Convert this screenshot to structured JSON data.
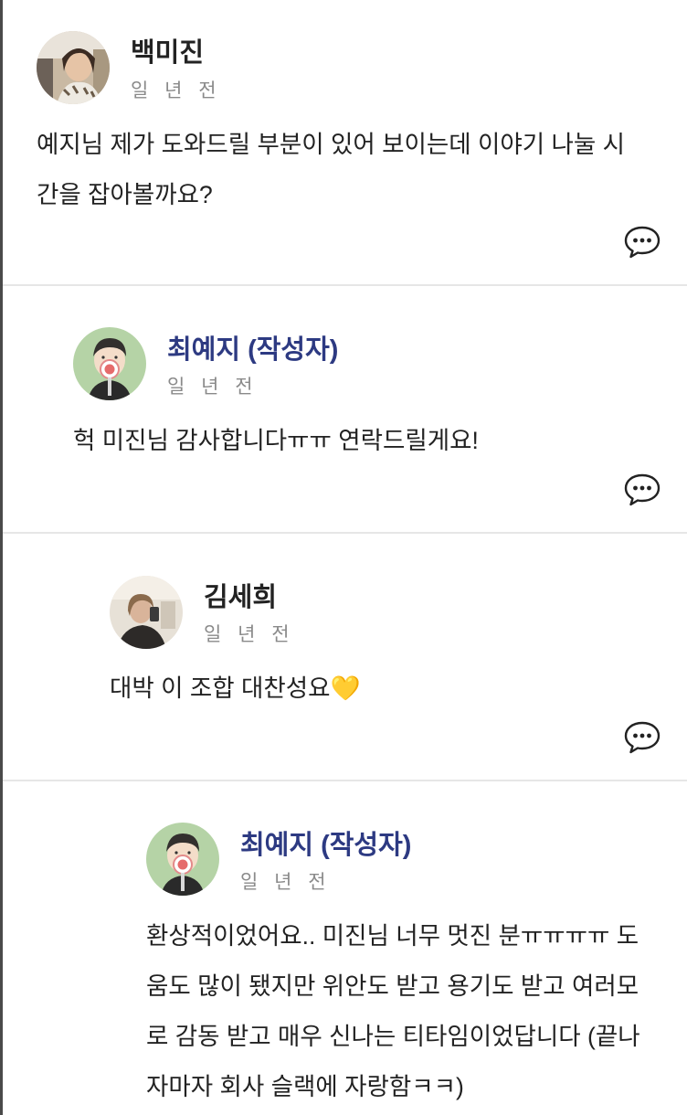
{
  "comments": [
    {
      "author": "백미진",
      "time": "일 년 전",
      "text": "예지님 제가 도와드릴  부분이 있어 보이는데 이야기 나눌 시간을 잡아볼까요?",
      "avatar": "photo-avatar-woman"
    },
    {
      "author": "최예지 (작성자)",
      "time": "일 년 전",
      "text": "헉 미진님 감사합니다ㅠㅠ 연락드릴게요!",
      "avatar": "cartoon-avatar-author"
    },
    {
      "author": "김세희",
      "time": "일 년 전",
      "text": "대박 이 조합 대찬성요",
      "emoji": "💛",
      "avatar": "photo-avatar-mirror-selfie"
    },
    {
      "author": "최예지 (작성자)",
      "time": "일 년 전",
      "text": "환상적이었어요.. 미진님 너무 멋진 분ㅠㅠㅠㅠ 도움도 많이 됐지만 위안도 받고 용기도 받고 여러모로 감동 받고 매우 신나는 티타임이었답니다 (끝나자마자 회사 슬랙에 자랑함ㅋㅋ)",
      "avatar": "cartoon-avatar-author"
    }
  ],
  "icons": {
    "reply": "speech-bubble-icon"
  },
  "colors": {
    "author_highlight": "#2d3a82",
    "timestamp": "#8a8a8a",
    "divider": "#e6e6e6",
    "cartoon_avatar_bg": "#b5d3a6"
  }
}
